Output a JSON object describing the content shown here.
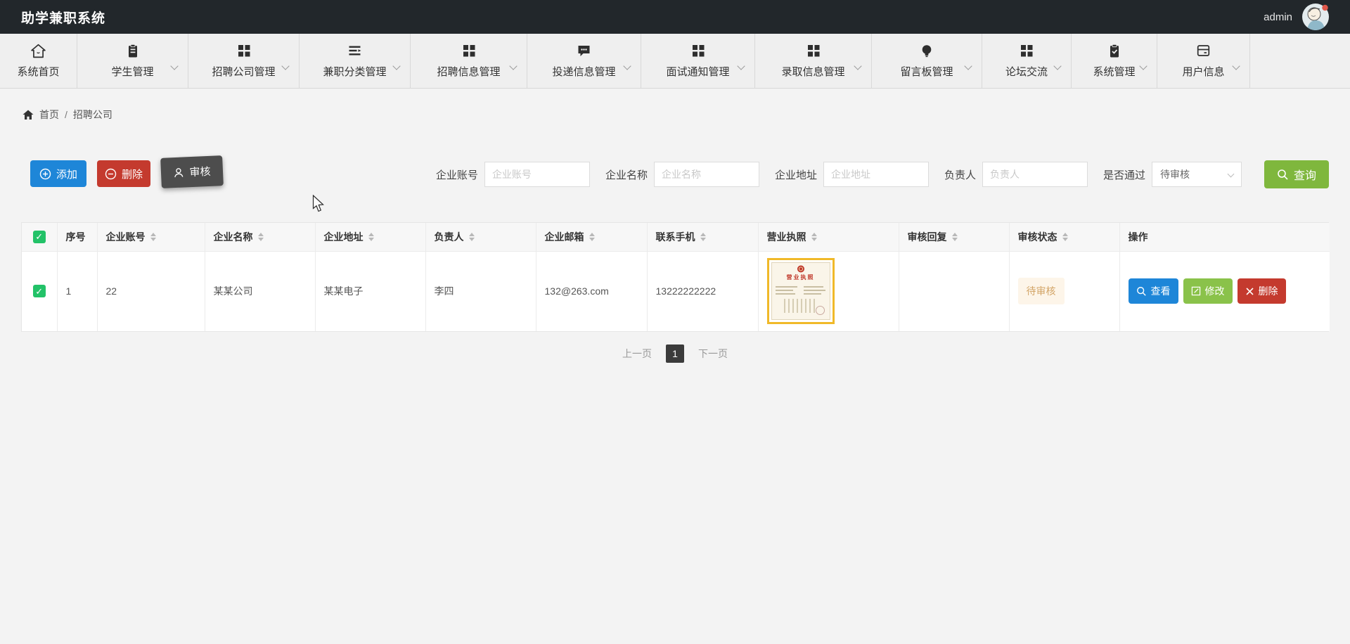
{
  "app": {
    "title": "助学兼职系统"
  },
  "user": {
    "name": "admin"
  },
  "nav": {
    "items": [
      {
        "label": "系统首页",
        "icon": "home-icon"
      },
      {
        "label": "学生管理",
        "icon": "clipboard-icon"
      },
      {
        "label": "招聘公司管理",
        "icon": "grid-icon"
      },
      {
        "label": "兼职分类管理",
        "icon": "list-icon"
      },
      {
        "label": "招聘信息管理",
        "icon": "grid-icon"
      },
      {
        "label": "投递信息管理",
        "icon": "chat-icon"
      },
      {
        "label": "面试通知管理",
        "icon": "grid-icon"
      },
      {
        "label": "录取信息管理",
        "icon": "grid-icon"
      },
      {
        "label": "留言板管理",
        "icon": "bulb-icon"
      },
      {
        "label": "论坛交流",
        "icon": "grid-icon"
      },
      {
        "label": "系统管理",
        "icon": "clipboard-check-icon"
      },
      {
        "label": "用户信息",
        "icon": "card-icon"
      }
    ]
  },
  "breadcrumb": {
    "home": "首页",
    "separator": "/",
    "current": "招聘公司"
  },
  "toolbar": {
    "add_label": "添加",
    "delete_label": "删除",
    "review_label": "审核"
  },
  "filters": {
    "account_label": "企业账号",
    "account_placeholder": "企业账号",
    "name_label": "企业名称",
    "name_placeholder": "企业名称",
    "address_label": "企业地址",
    "address_placeholder": "企业地址",
    "manager_label": "负责人",
    "manager_placeholder": "负责人",
    "pass_label": "是否通过",
    "pass_value": "待审核",
    "search_label": "查询"
  },
  "table": {
    "columns": [
      {
        "label": "序号",
        "sortable": false
      },
      {
        "label": "企业账号",
        "sortable": true
      },
      {
        "label": "企业名称",
        "sortable": true
      },
      {
        "label": "企业地址",
        "sortable": true
      },
      {
        "label": "负责人",
        "sortable": true
      },
      {
        "label": "企业邮箱",
        "sortable": true
      },
      {
        "label": "联系手机",
        "sortable": true
      },
      {
        "label": "营业执照",
        "sortable": true
      },
      {
        "label": "审核回复",
        "sortable": true
      },
      {
        "label": "审核状态",
        "sortable": true
      },
      {
        "label": "操作",
        "sortable": false
      }
    ],
    "rows": [
      {
        "index": "1",
        "account": "22",
        "company_name": "某某公司",
        "address": "某某电子",
        "manager": "李四",
        "email": "132@263.com",
        "phone": "13222222222",
        "license_title": "营业执照",
        "review_reply": "",
        "status": "待审核"
      }
    ]
  },
  "row_actions": {
    "view_label": "查看",
    "edit_label": "修改",
    "delete_label": "删除"
  },
  "pagination": {
    "prev_label": "上一页",
    "current_page": "1",
    "next_label": "下一页"
  },
  "colors": {
    "topbar_bg": "#22272b",
    "primary_blue": "#1e86d8",
    "danger_red": "#c43a2e",
    "dark_button": "#4d4d4d",
    "search_green": "#7fb73d",
    "edit_green": "#8ac24a",
    "checkbox_green": "#23c268",
    "status_badge_bg": "#fdf5e9",
    "status_badge_text": "#d3a567",
    "license_border": "#f0b929"
  }
}
